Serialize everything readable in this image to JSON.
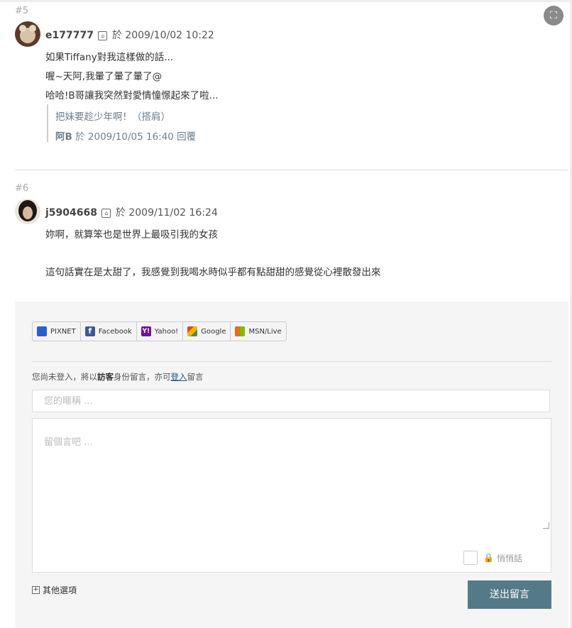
{
  "comments": [
    {
      "number": "#5",
      "author": "e177777",
      "date_prefix": "於",
      "date": "2009/10/02 10:22",
      "lines": [
        "如果Tiffany對我這樣做的話...",
        "喔~天阿,我暈了暈了暈了@",
        "哈哈!B哥讓我突然對愛情憧憬起來了啦..."
      ],
      "reply": {
        "text": "把妹要趁少年啊！（搭肩）",
        "author": "阿B",
        "meta": "於 2009/10/05 16:40 回覆"
      }
    },
    {
      "number": "#6",
      "author": "j5904668",
      "date_prefix": "於",
      "date": "2009/11/02 16:24",
      "lines": [
        "妳啊，就算笨也是世界上最吸引我的女孩",
        "",
        "這句話實在是太甜了，我感覺到我喝水時似乎都有點甜甜的感覺從心裡散發出來"
      ]
    }
  ],
  "login_providers": [
    {
      "label": "PIXNET",
      "color": "#2a5fd0"
    },
    {
      "label": "Facebook",
      "color": "#3b5998"
    },
    {
      "label": "Yahoo!",
      "color": "#720e9e"
    },
    {
      "label": "Google",
      "color": "#4a8f3a"
    },
    {
      "label": "MSN/Live",
      "color": "#e46b1c"
    }
  ],
  "form": {
    "notice_pre": "您尚未登入，將以",
    "notice_guest": "訪客",
    "notice_mid": "身份留言，亦可",
    "notice_login": "登入",
    "notice_post": "留言",
    "nickname_placeholder": "您的暱稱 ...",
    "message_placeholder": "留個言吧 ...",
    "private_label": "悄悄話",
    "more_options": "其他選項",
    "submit_label": "送出留言"
  }
}
